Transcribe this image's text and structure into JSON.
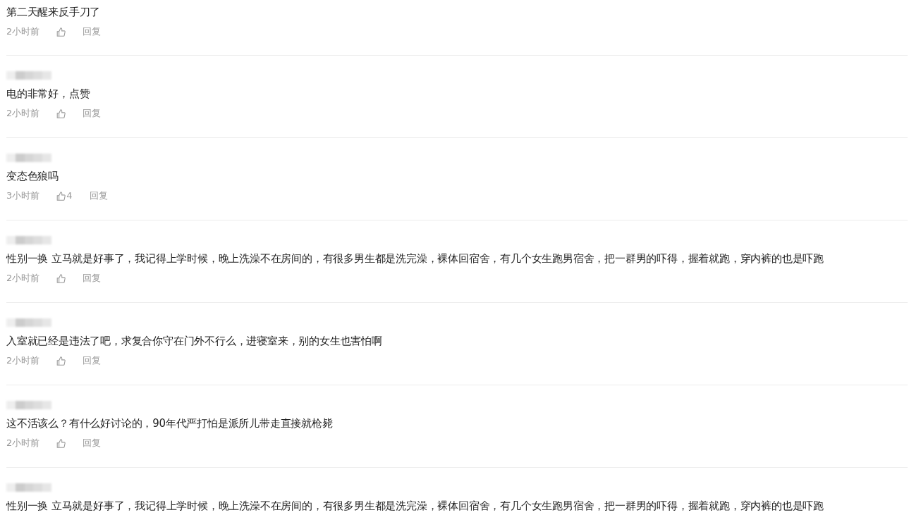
{
  "comments": [
    {
      "text": "第二天醒来反手刀了",
      "time": "2小时前",
      "reply": "回复"
    },
    {
      "username_blurred": true,
      "text": "电的非常好，点赞",
      "time": "2小时前",
      "reply": "回复"
    },
    {
      "username_blurred": true,
      "text": "变态色狼吗",
      "time": "3小时前",
      "likes": "4",
      "reply": "回复"
    },
    {
      "username_blurred": true,
      "text": "性别一换  立马就是好事了，我记得上学时候，晚上洗澡不在房间的，有很多男生都是洗完澡，裸体回宿舍，有几个女生跑男宿舍，把一群男的吓得，握着就跑，穿内裤的也是吓跑",
      "time": "2小时前",
      "reply": "回复"
    },
    {
      "username_blurred": true,
      "text": "入室就已经是违法了吧，求复合你守在门外不行么，进寝室来，别的女生也害怕啊",
      "time": "2小时前",
      "reply": "回复"
    },
    {
      "username_blurred": true,
      "text": "这不活该么？有什么好讨论的，90年代严打怕是派所儿带走直接就枪毙",
      "time": "2小时前",
      "reply": "回复"
    },
    {
      "username_blurred": true,
      "text": "性别一换  立马就是好事了，我记得上学时候，晚上洗澡不在房间的，有很多男生都是洗完澡，裸体回宿舍，有几个女生跑男宿舍，把一群男的吓得，握着就跑，穿内裤的也是吓跑"
    }
  ]
}
